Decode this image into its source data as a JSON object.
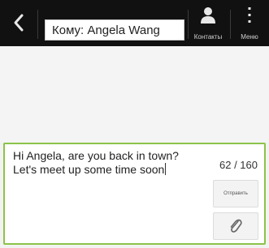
{
  "header": {
    "to_field": "Кому: Angela Wang",
    "contacts_label": "Контакты",
    "menu_label": "Меню"
  },
  "composer": {
    "line1": "Hi Angela, are you back in town?",
    "line2": "Let's meet up some time soon",
    "char_counter": "62 / 160",
    "send_label": "Отправить"
  },
  "icons": {
    "back": "chevron-left-icon",
    "contacts": "person-icon",
    "menu": "vertical-dots-icon",
    "attach": "paperclip-icon"
  },
  "colors": {
    "topbar": "#111111",
    "compose_border": "#8bc34a"
  }
}
